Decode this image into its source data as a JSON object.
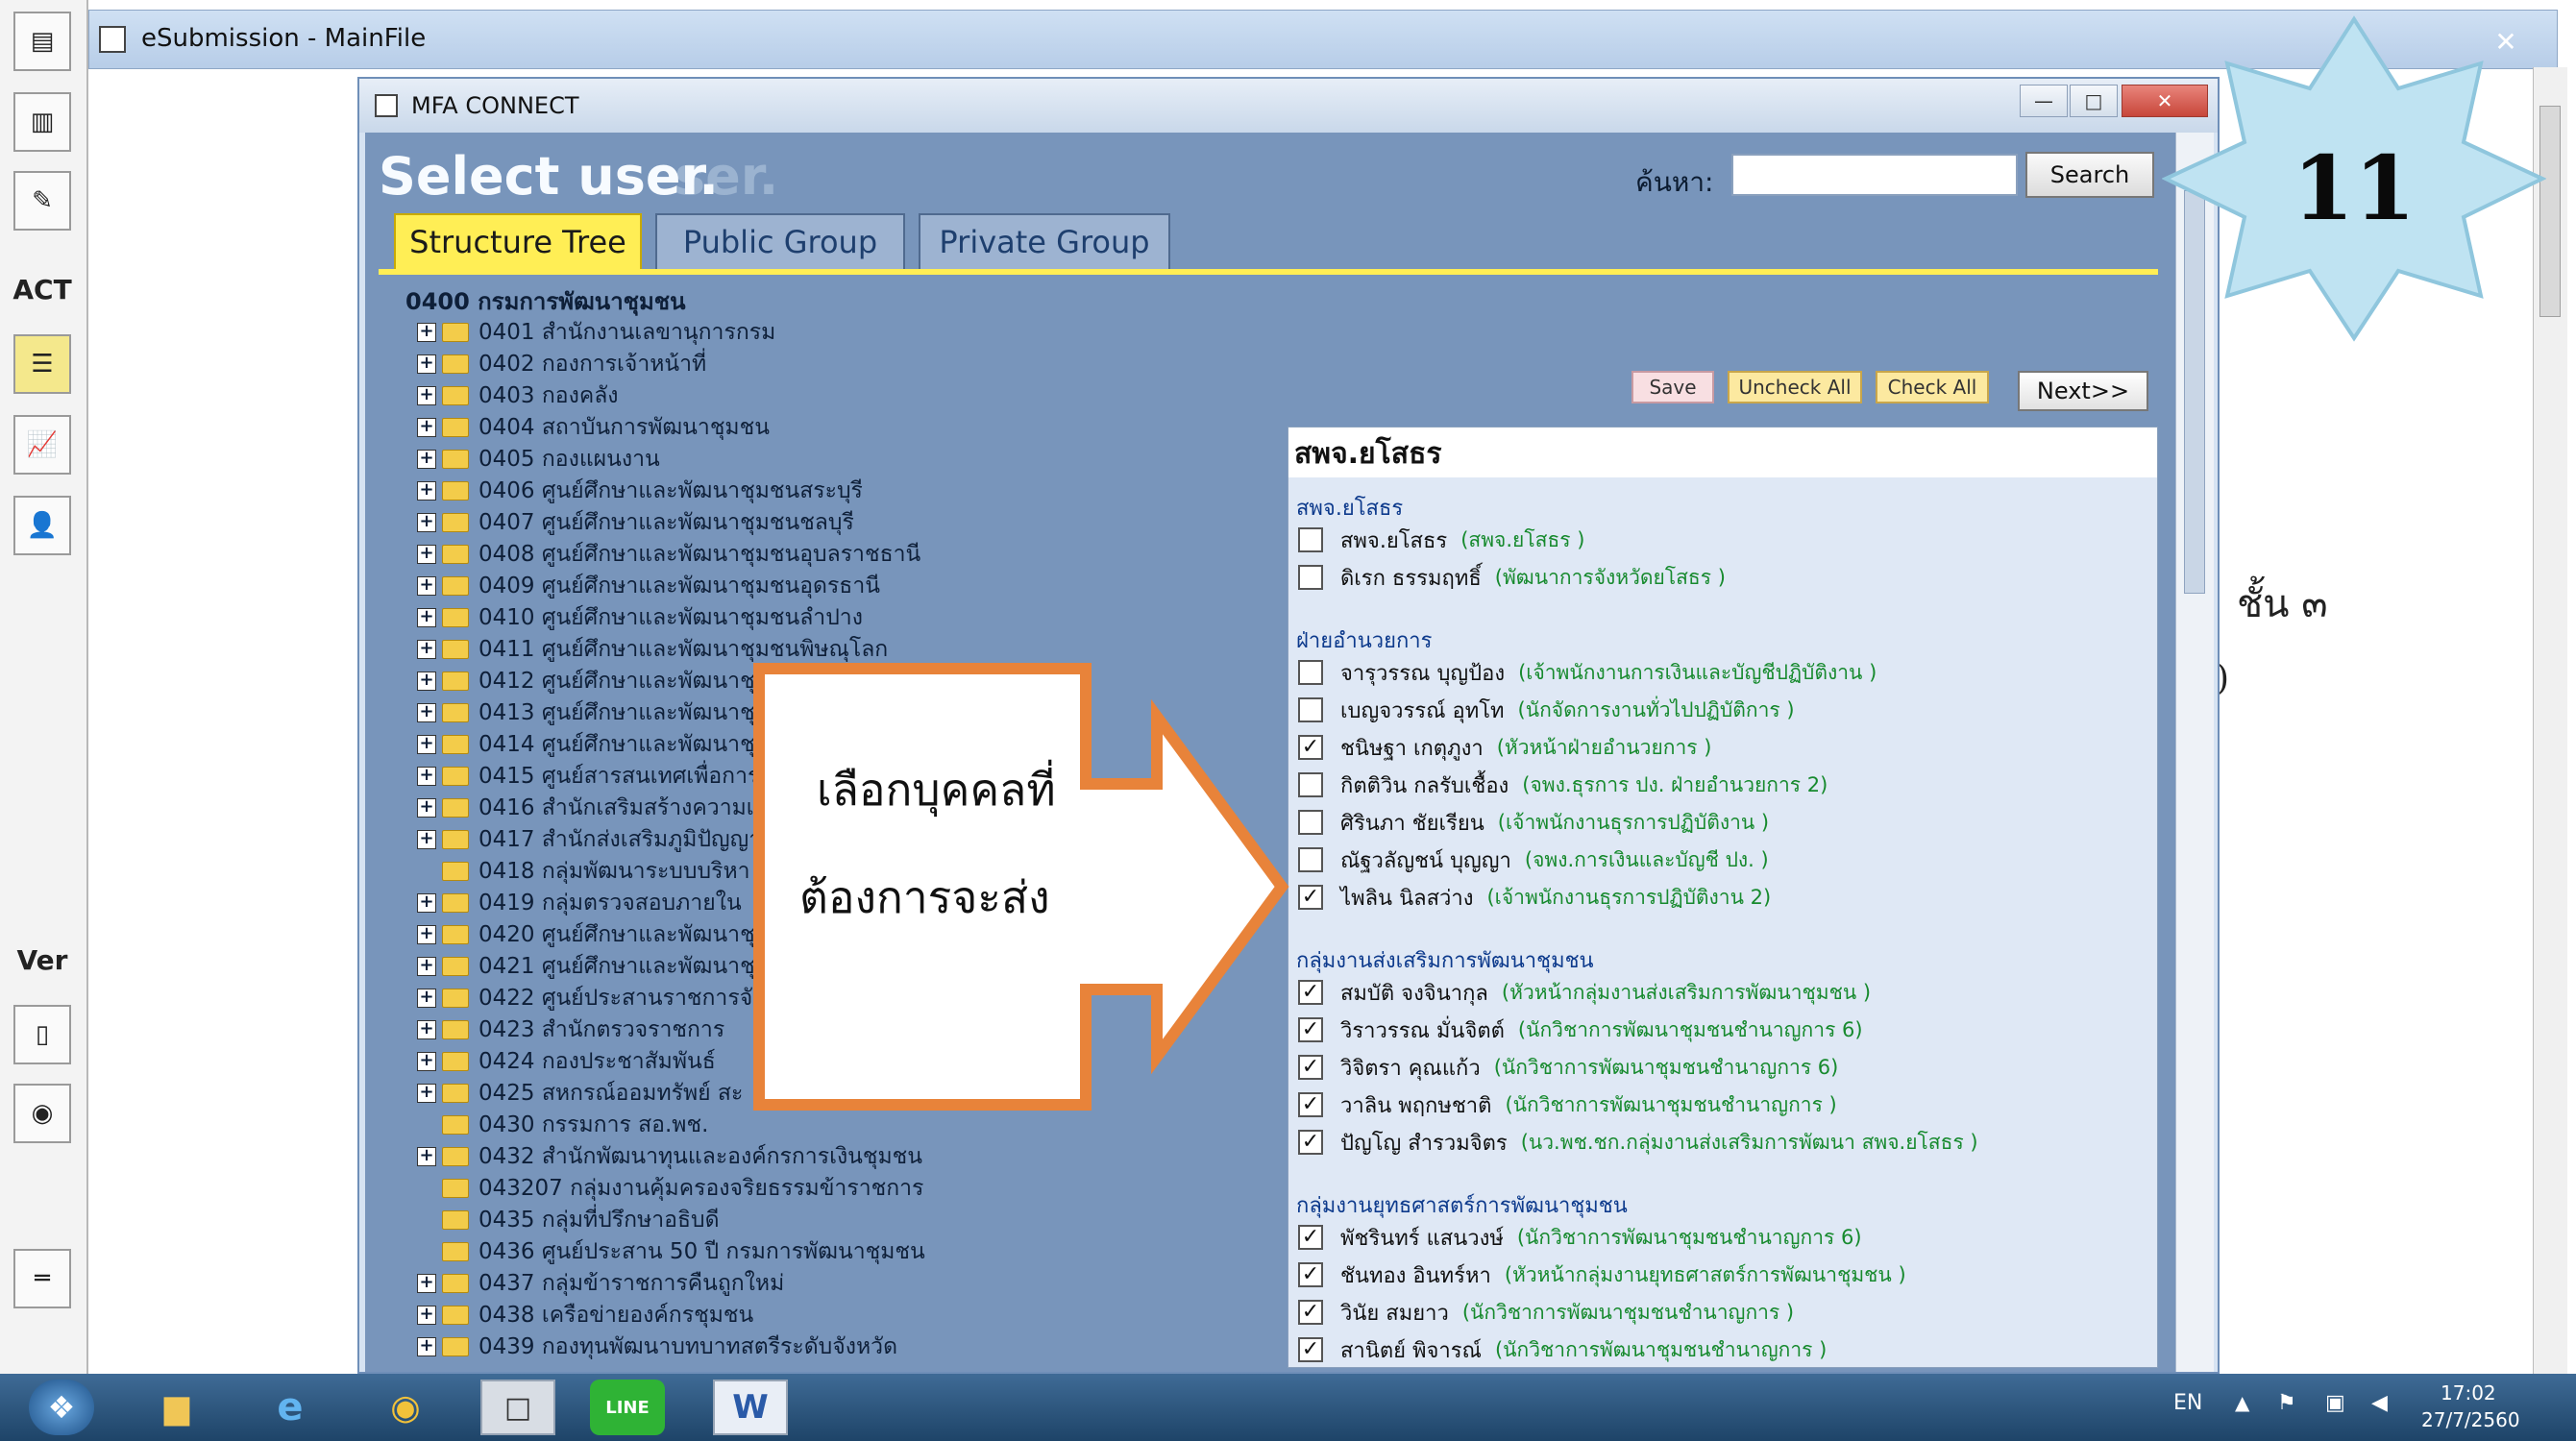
{
  "outer_window": {
    "title": "eSubmission - MainFile",
    "close_glyph": "✕"
  },
  "left_toolbar": {
    "act_label": "ACT",
    "ver_label": "Ver"
  },
  "background_doc": {
    "line1": "ชั้น ๓",
    "line2": ")"
  },
  "dialog": {
    "title": "MFA CONNECT",
    "heading": "Select user.",
    "heading_ghost": "ser.",
    "search_label": "ค้นหา:",
    "search_value": "",
    "search_button": "Search",
    "min_glyph": "—",
    "max_glyph": "□",
    "close_glyph": "✕",
    "tabs": [
      {
        "label": "Structure Tree",
        "active": true
      },
      {
        "label": "Public Group",
        "active": false
      },
      {
        "label": "Private Group",
        "active": false
      }
    ]
  },
  "tree": {
    "root": "0400 กรมการพัฒนาชุมชน",
    "items": [
      {
        "label": "0401 สำนักงานเลขานุการกรม",
        "expandable": true
      },
      {
        "label": "0402 กองการเจ้าหน้าที่",
        "expandable": true
      },
      {
        "label": "0403 กองคลัง",
        "expandable": true
      },
      {
        "label": "0404 สถาบันการพัฒนาชุมชน",
        "expandable": true
      },
      {
        "label": "0405 กองแผนงาน",
        "expandable": true
      },
      {
        "label": "0406 ศูนย์ศึกษาและพัฒนาชุมชนสระบุรี",
        "expandable": true
      },
      {
        "label": "0407 ศูนย์ศึกษาและพัฒนาชุมชนชลบุรี",
        "expandable": true
      },
      {
        "label": "0408 ศูนย์ศึกษาและพัฒนาชุมชนอุบลราชธานี",
        "expandable": true
      },
      {
        "label": "0409 ศูนย์ศึกษาและพัฒนาชุมชนอุดรธานี",
        "expandable": true
      },
      {
        "label": "0410 ศูนย์ศึกษาและพัฒนาชุมชนลำปาง",
        "expandable": true
      },
      {
        "label": "0411 ศูนย์ศึกษาและพัฒนาชุมชนพิษณุโลก",
        "expandable": true
      },
      {
        "label": "0412 ศูนย์ศึกษาและพัฒนาชุ",
        "expandable": true
      },
      {
        "label": "0413 ศูนย์ศึกษาและพัฒนาชุ",
        "expandable": true
      },
      {
        "label": "0414 ศูนย์ศึกษาและพัฒนาชุ",
        "expandable": true
      },
      {
        "label": "0415 ศูนย์สารสนเทศเพื่อการ",
        "expandable": true
      },
      {
        "label": "0416 สำนักเสริมสร้างความเข",
        "expandable": true
      },
      {
        "label": "0417 สำนักส่งเสริมภูมิปัญญา",
        "expandable": true
      },
      {
        "label": "0418 กลุ่มพัฒนาระบบบริหา",
        "expandable": false
      },
      {
        "label": "0419 กลุ่มตรวจสอบภายใน",
        "expandable": true
      },
      {
        "label": "0420 ศูนย์ศึกษาและพัฒนาชุ",
        "expandable": true
      },
      {
        "label": "0421 ศูนย์ศึกษาและพัฒนาชุ",
        "expandable": true
      },
      {
        "label": "0422 ศูนย์ประสานราชการจั",
        "expandable": true
      },
      {
        "label": "0423 สำนักตรวจราชการ",
        "expandable": true
      },
      {
        "label": "0424 กองประชาสัมพันธ์",
        "expandable": true
      },
      {
        "label": "0425 สหกรณ์ออมทรัพย์ สะ",
        "expandable": true
      },
      {
        "label": "0430 กรรมการ สอ.พช.",
        "expandable": false
      },
      {
        "label": "0432 สำนักพัฒนาทุนและองค์กรการเงินชุมชน",
        "expandable": true
      },
      {
        "label": "043207 กลุ่มงานคุ้มครองจริยธรรมข้าราชการ",
        "expandable": false
      },
      {
        "label": "0435 กลุ่มที่ปรึกษาอธิบดี",
        "expandable": false
      },
      {
        "label": "0436 ศูนย์ประสาน 50 ปี กรมการพัฒนาชุมชน",
        "expandable": false
      },
      {
        "label": "0437 กลุ่มข้าราชการคืนถูกใหม่",
        "expandable": true
      },
      {
        "label": "0438 เครือข่ายองค์กรชุมชน",
        "expandable": true
      },
      {
        "label": "0439 กองทุนพัฒนาบทบาทสตรีระดับจังหวัด",
        "expandable": true
      }
    ]
  },
  "actions": {
    "save": "Save",
    "uncheck_all": "Uncheck All",
    "check_all": "Check All",
    "next": "Next>>"
  },
  "panel": {
    "title": "สพจ.ยโสธร",
    "groups": [
      {
        "name": "สพจ.ยโสธร",
        "members": [
          {
            "name": "สพจ.ยโสธร",
            "position": "(สพจ.ยโสธร )",
            "checked": false
          },
          {
            "name": "ดิเรก ธรรมฤทธิ์",
            "position": "(พัฒนาการจังหวัดยโสธร )",
            "checked": false
          }
        ]
      },
      {
        "name": "ฝ่ายอำนวยการ",
        "members": [
          {
            "name": "จารุวรรณ บุญป้อง",
            "position": "(เจ้าพนักงานการเงินและบัญชีปฏิบัติงาน )",
            "checked": false
          },
          {
            "name": "เบญจวรรณ์ อุทโท",
            "position": "(นักจัดการงานทั่วไปปฏิบัติการ )",
            "checked": false
          },
          {
            "name": "ชนิษฐา เกตุภูงา",
            "position": "(หัวหน้าฝ่ายอำนวยการ )",
            "checked": true
          },
          {
            "name": "กิตติวิน กลรับเชื้อง",
            "position": "(จพง.ธุรการ ปง. ฝ่ายอำนวยการ 2)",
            "checked": false
          },
          {
            "name": "ศิรินภา ชัยเรียน",
            "position": "(เจ้าพนักงานธุรการปฏิบัติงาน )",
            "checked": false
          },
          {
            "name": "ณัฐวลัญชน์ บุญญา",
            "position": "(จพง.การเงินและบัญชี ปง. )",
            "checked": false
          },
          {
            "name": "ไพลิน นิลสว่าง",
            "position": "(เจ้าพนักงานธุรการปฏิบัติงาน 2)",
            "checked": true
          }
        ]
      },
      {
        "name": "กลุ่มงานส่งเสริมการพัฒนาชุมชน",
        "members": [
          {
            "name": "สมบัติ จงจินากุล",
            "position": "(หัวหน้ากลุ่มงานส่งเสริมการพัฒนาชุมชน )",
            "checked": true
          },
          {
            "name": "วิราวรรณ มั่นจิตต์",
            "position": "(นักวิชาการพัฒนาชุมชนชำนาญการ 6)",
            "checked": true
          },
          {
            "name": "วิจิตรา คุณแก้ว",
            "position": "(นักวิชาการพัฒนาชุมชนชำนาญการ 6)",
            "checked": true
          },
          {
            "name": "วาลิน พฤกษชาติ",
            "position": "(นักวิชาการพัฒนาชุมชนชำนาญการ )",
            "checked": true
          },
          {
            "name": "ปัญโญ สำรวมจิตร",
            "position": "(นว.พช.ชก.กลุ่มงานส่งเสริมการพัฒนา สพจ.ยโสธร )",
            "checked": true
          }
        ]
      },
      {
        "name": "กลุ่มงานยุทธศาสตร์การพัฒนาชุมชน",
        "members": [
          {
            "name": "พัชรินทร์ แสนวงษ์",
            "position": "(นักวิชาการพัฒนาชุมชนชำนาญการ 6)",
            "checked": true
          },
          {
            "name": "ชันทอง อินทร์หา",
            "position": "(หัวหน้ากลุ่มงานยุทธศาสตร์การพัฒนาชุมชน )",
            "checked": true
          },
          {
            "name": "วินัย สมยาว",
            "position": "(นักวิชาการพัฒนาชุมชนชำนาญการ )",
            "checked": true
          },
          {
            "name": "สานิตย์ พิจารณ์",
            "position": "(นักวิชาการพัฒนาชุมชนชำนาญการ )",
            "checked": true
          }
        ]
      }
    ]
  },
  "callout": {
    "line1": "เลือกบุคคลที่",
    "line2": "ต้องการจะส่ง"
  },
  "step_badge": {
    "number": "11"
  },
  "taskbar": {
    "lang": "EN",
    "time": "17:02",
    "date": "27/7/2560",
    "start_glyph": "❖",
    "word_glyph": "W",
    "line_glyph": "LINE"
  },
  "colors": {
    "dialog_bg": "#7895bb",
    "tab_active": "#ffee55",
    "check_group": "#0d3a8c",
    "position_text": "#178a2e",
    "callout_border": "#e8833a",
    "star_fill": "#bfe3f2"
  }
}
